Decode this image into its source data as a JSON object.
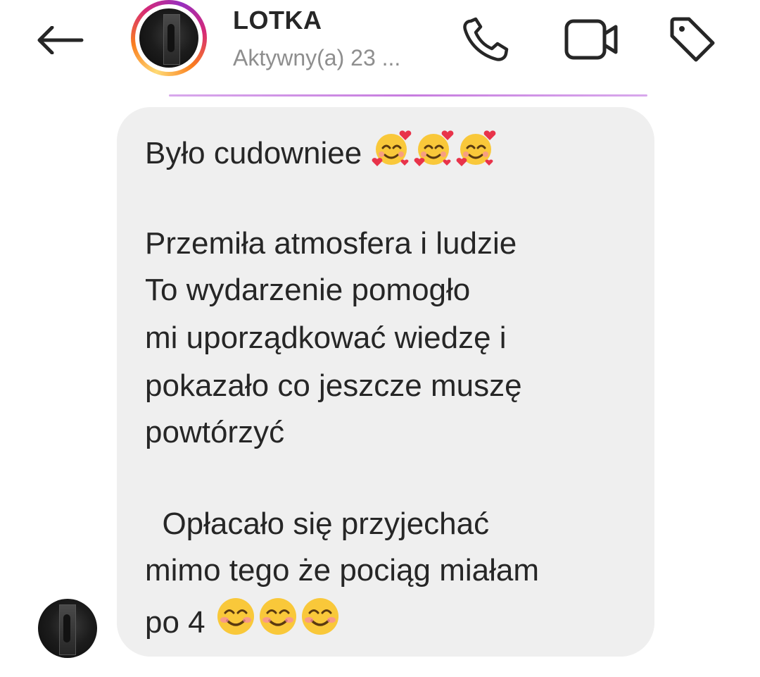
{
  "header": {
    "contact_name": "LOTKA",
    "status": "Aktywny(a) 23 ...",
    "icons": {
      "back": "arrow-left-icon",
      "call": "phone-icon",
      "video": "video-camera-icon",
      "tag": "tag-icon"
    },
    "ring_colors": [
      "#feda75",
      "#fa7e1e",
      "#d62976",
      "#962fbf"
    ]
  },
  "message": {
    "lines": [
      "Było cudowniee",
      "Przemiła atmosfera i ludzie",
      "To wydarzenie pomogło",
      "mi uporządkować wiedzę i",
      "pokazało co jeszcze muszę",
      "powtórzyć",
      "  Opłacało się przyjechać",
      "mimo tego że pociąg miałam",
      "po 4"
    ],
    "line1_emoji": [
      "smiling-face-with-hearts",
      "smiling-face-with-hearts",
      "smiling-face-with-hearts"
    ],
    "last_line_emoji": [
      "smiling-face-with-smiling-eyes",
      "smiling-face-with-smiling-eyes",
      "smiling-face-with-smiling-eyes"
    ],
    "bubble_color": "#efefef",
    "text_color": "#262626"
  }
}
